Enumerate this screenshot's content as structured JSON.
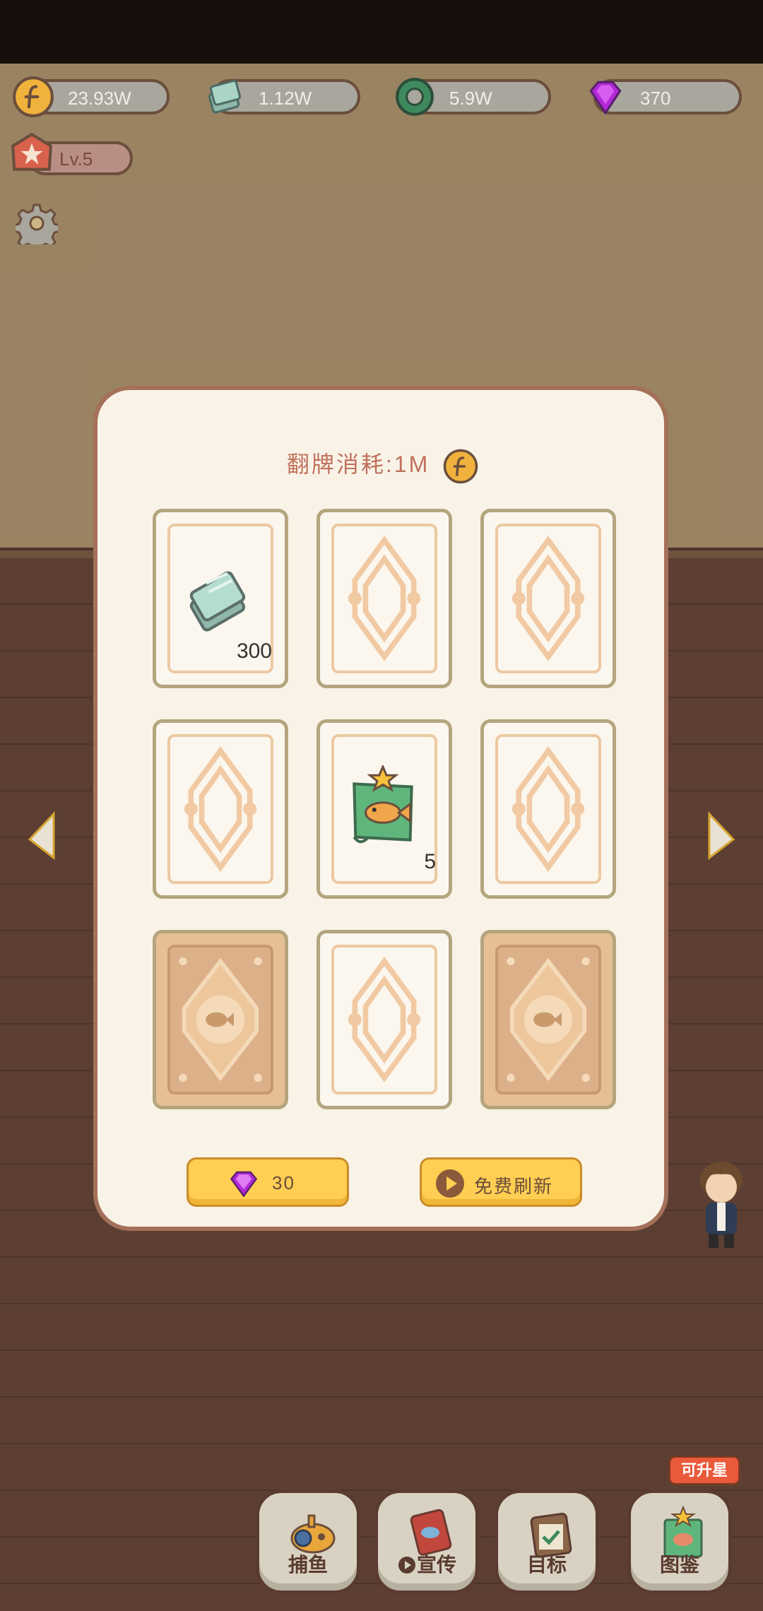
{
  "resources": [
    {
      "name": "coin",
      "value": "23.93W"
    },
    {
      "name": "ticket",
      "value": "1.12W"
    },
    {
      "name": "bait",
      "value": "5.9W"
    },
    {
      "name": "gem",
      "value": "370"
    }
  ],
  "level": {
    "value": "Lv.5"
  },
  "dialog": {
    "cost_label": "翻牌消耗:1M",
    "cards": [
      {
        "state": "revealed",
        "item": "ticket-stack",
        "amount": "300"
      },
      {
        "state": "back"
      },
      {
        "state": "back"
      },
      {
        "state": "back"
      },
      {
        "state": "revealed",
        "item": "fish-card",
        "amount": "5"
      },
      {
        "state": "back"
      },
      {
        "state": "special"
      },
      {
        "state": "back"
      },
      {
        "state": "special"
      }
    ],
    "gem_refresh": {
      "cost": "30"
    },
    "free_refresh": {
      "label": "免费刷新"
    }
  },
  "nav": {
    "fishing": "捕鱼",
    "promote": "宣传",
    "goals": "目标",
    "collection": "图鉴",
    "collection_badge": "可升星"
  },
  "colors": {
    "dialog_bg": "#f9f3e7",
    "dialog_border": "#a5705a",
    "button_yellow": "#ffce52",
    "cost_text": "#c0705c",
    "badge_red": "#ea5a3a"
  }
}
